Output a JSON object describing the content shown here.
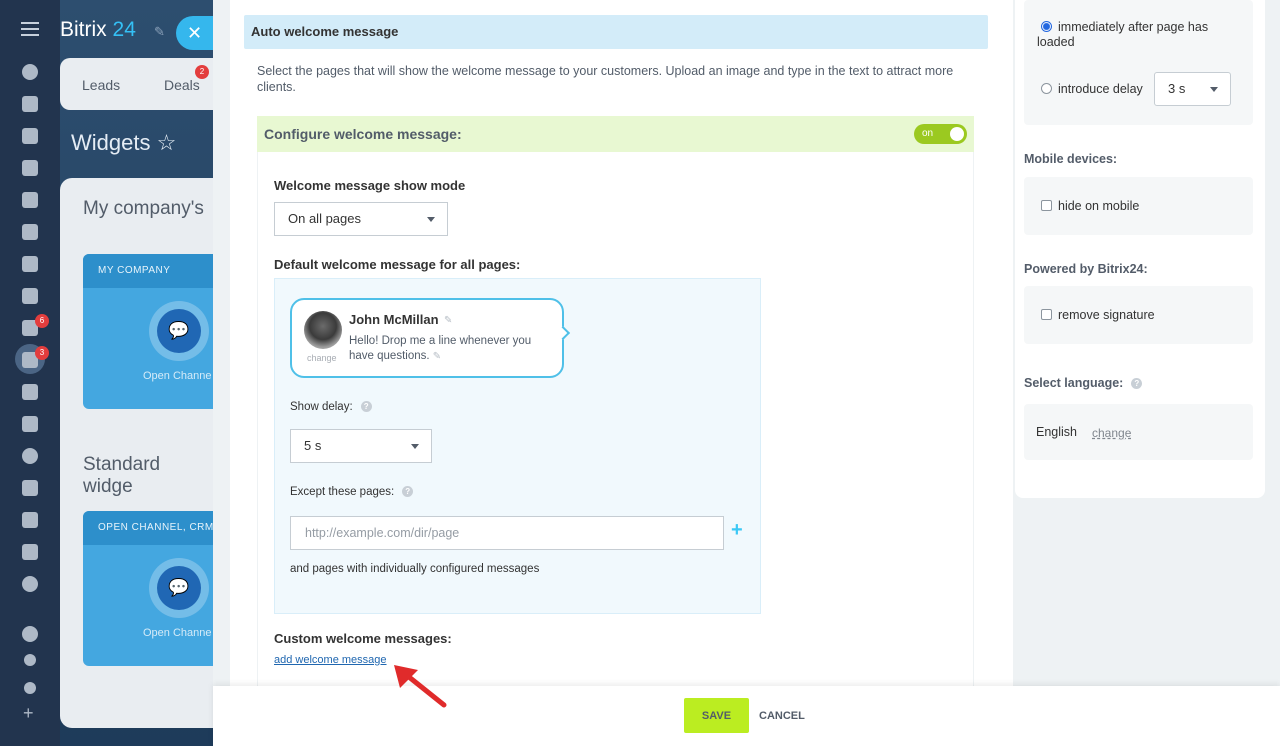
{
  "background": {
    "brand_name": "Bitrix",
    "brand_number": "24",
    "tabs": [
      "Leads",
      "Deals"
    ],
    "deals_count": "2",
    "page_title": "Widgets ☆",
    "tasks_badge": "6",
    "crm_badge": "3",
    "section1": "My company's",
    "card1_title": "MY COMPANY",
    "card1_label": "Open Channe",
    "section2": "Standard widge",
    "card2_title": "OPEN CHANNEL, CRM",
    "card2_label": "Open Channe"
  },
  "main": {
    "section_title": "Auto welcome message",
    "intro": "Select the pages that will show the welcome message to your customers. Upload an image and type in the text to attract more clients.",
    "config_title": "Configure welcome message:",
    "toggle_label": "on",
    "show_mode_label": "Welcome message show mode",
    "show_mode_value": "On all pages",
    "default_msg_label": "Default welcome message for all pages:",
    "operator_name": "John McMillan",
    "avatar_change": "change",
    "message_text": "Hello! Drop me a line whenever you have questions.",
    "show_delay_label": "Show delay:",
    "show_delay_value": "5 s",
    "except_label": "Except these pages:",
    "except_placeholder": "http://example.com/dir/page",
    "individual_note": "and pages with individually configured messages",
    "custom_label": "Custom welcome messages:",
    "add_link": "add welcome message"
  },
  "right": {
    "radio_immediate": "immediately after page has loaded",
    "radio_delay": "introduce delay",
    "delay_value": "3 s",
    "mobile_label": "Mobile devices:",
    "hide_mobile": "hide on mobile",
    "powered_label": "Powered by Bitrix24:",
    "remove_signature": "remove signature",
    "language_label": "Select language:",
    "language_value": "English",
    "language_change": "change"
  },
  "footer": {
    "save": "SAVE",
    "cancel": "CANCEL"
  },
  "colors": {
    "accent": "#3bc8f5",
    "save_button": "#bbed21",
    "toggle_on": "#9bc920",
    "arrow": "#e02b2b"
  }
}
